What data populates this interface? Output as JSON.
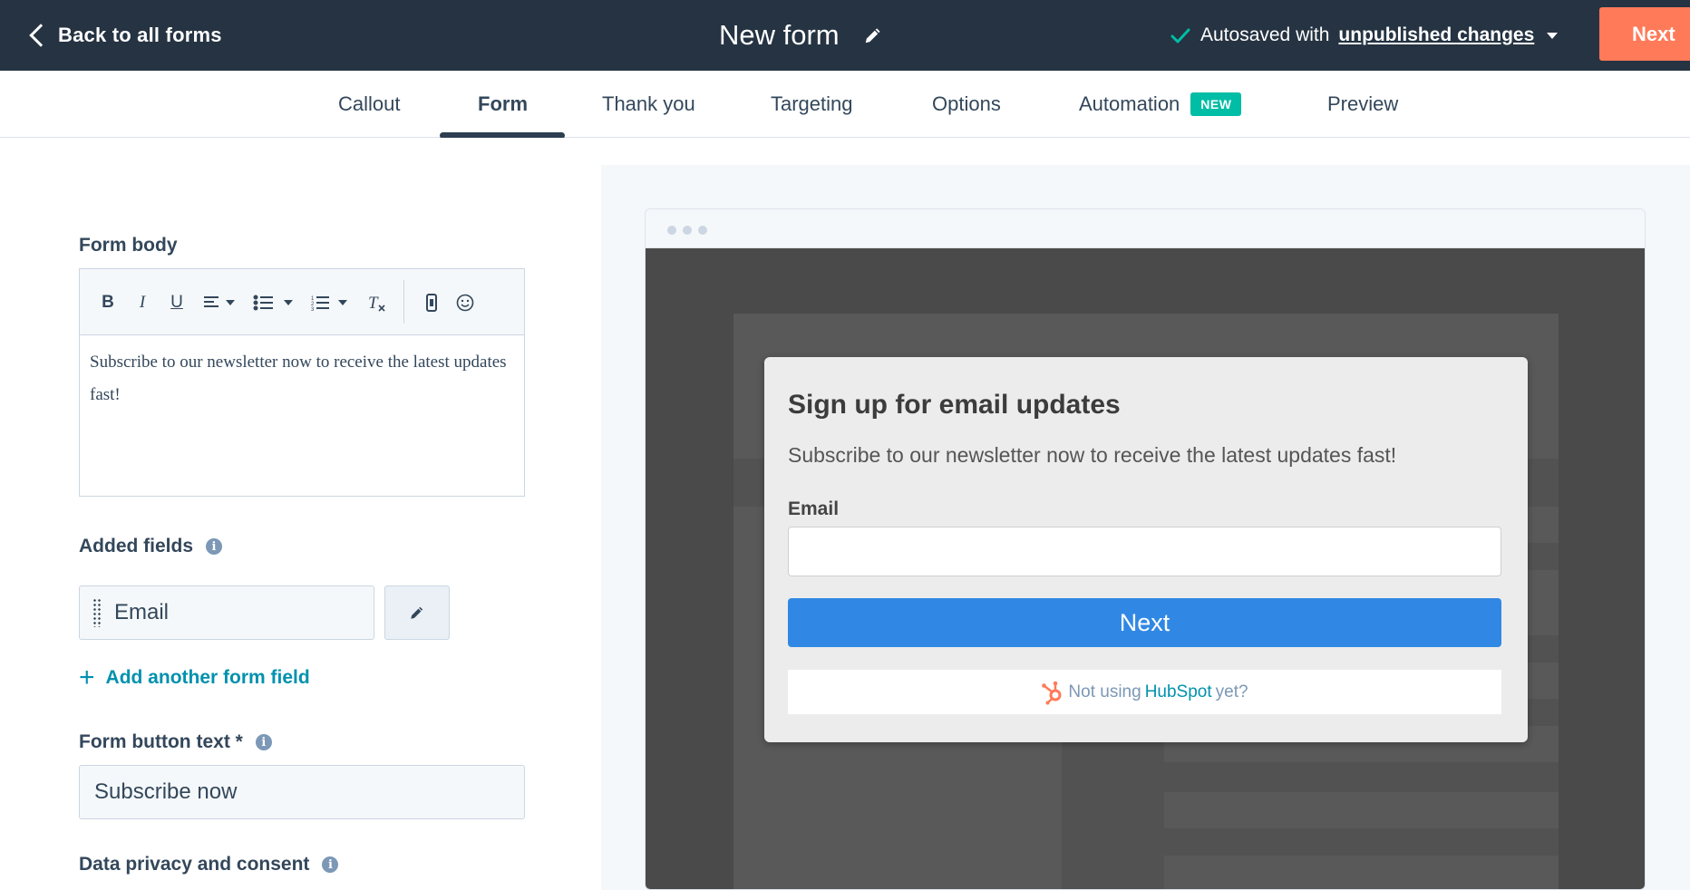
{
  "header": {
    "back_label": "Back to all forms",
    "form_title": "New form",
    "autosave_prefix": "Autosaved with",
    "autosave_changes": "unpublished changes",
    "next_label": "Next"
  },
  "tabs": [
    {
      "label": "Callout"
    },
    {
      "label": "Form"
    },
    {
      "label": "Thank you"
    },
    {
      "label": "Targeting"
    },
    {
      "label": "Options"
    },
    {
      "label": "Automation",
      "badge": "NEW"
    },
    {
      "label": "Preview"
    }
  ],
  "editor_panel": {
    "form_body_label": "Form body",
    "form_body_text": "Subscribe to our newsletter now to receive the latest updates fast!",
    "added_fields_label": "Added fields",
    "fields": [
      {
        "name": "Email"
      }
    ],
    "add_field_label": "Add another form field",
    "button_text_label": "Form button text *",
    "button_text_value": "Subscribe now",
    "privacy_label": "Data privacy and consent"
  },
  "preview": {
    "title": "Sign up for email updates",
    "body": "Subscribe to our newsletter now to receive the latest updates fast!",
    "email_label": "Email",
    "button_label": "Next",
    "footer_prefix": "Not using",
    "footer_brand": "HubSpot",
    "footer_suffix": "yet?"
  },
  "colors": {
    "topbar": "#253342",
    "accent_orange": "#ff7a59",
    "badge_teal": "#00bda5",
    "link_teal": "#0091ae",
    "preview_button": "#3088e4"
  }
}
